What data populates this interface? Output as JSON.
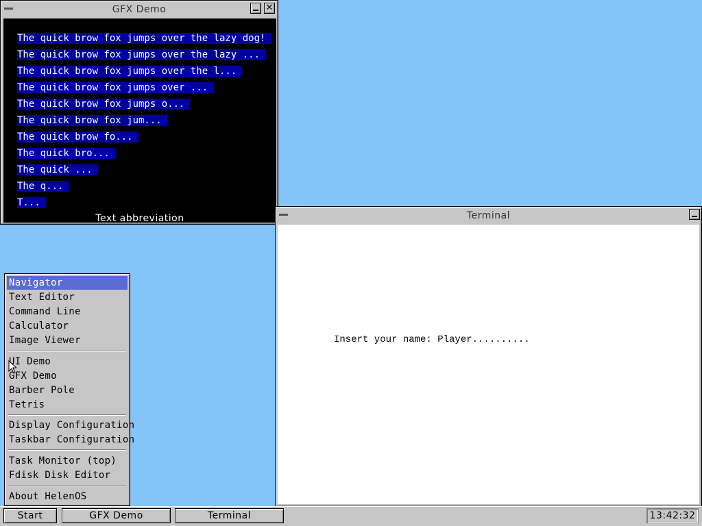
{
  "gfx_window": {
    "title": "GFX Demo",
    "minimize_glyph": "",
    "close_glyph": "✕",
    "lines": [
      "The quick brow fox jumps over the lazy dog!",
      "The quick brow fox jumps over the lazy ...",
      "The quick brow fox jumps over the l...",
      "The quick brow fox jumps over ...",
      "The quick brow fox jumps o...",
      "The quick brow fox jum...",
      "The quick brow fo...",
      "The quick bro...",
      "The quick ...",
      "The q...",
      "T..."
    ],
    "caption": "Text abbreviation"
  },
  "terminal_window": {
    "title": "Terminal",
    "content": "Insert your name: Player.........."
  },
  "start_menu": {
    "items": [
      "Navigator",
      "Text Editor",
      "Command Line",
      "Calculator",
      "Image Viewer",
      "UI Demo",
      "GFX Demo",
      "Barber Pole",
      "Tetris",
      "Display Configuration",
      "Taskbar Configuration",
      "Task Monitor (top)",
      "Fdisk Disk Editor",
      "About HelenOS"
    ],
    "selected": "Navigator"
  },
  "taskbar": {
    "start_label": "Start",
    "tasks": [
      "GFX Demo",
      "Terminal"
    ],
    "clock": "13:42:32"
  },
  "colors": {
    "desktop": "#84c4f8",
    "highlight": "#5a6cd0",
    "abbr_bg": "#0000a0"
  },
  "icons": [
    "system-menu-icon",
    "minimize-icon",
    "close-icon",
    "mouse-pointer-icon"
  ]
}
